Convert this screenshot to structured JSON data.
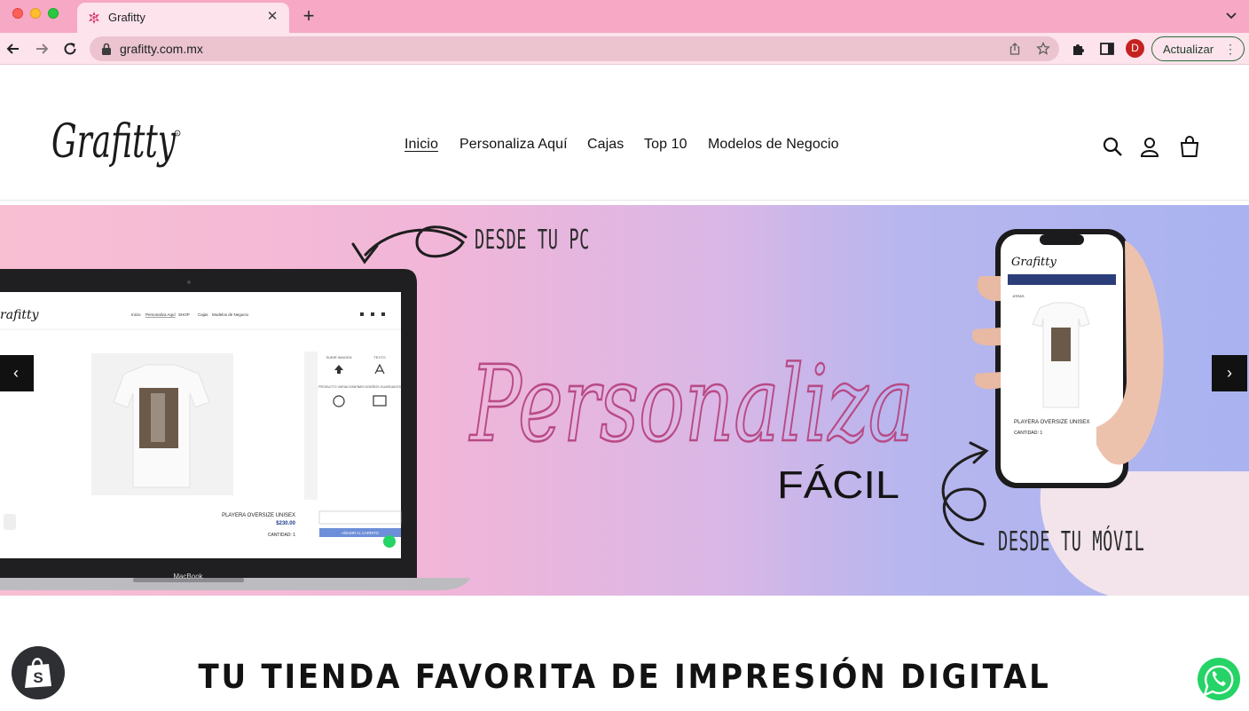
{
  "browser": {
    "tab_title": "Grafitty",
    "new_tab_symbol": "+",
    "url": "grafitty.com.mx",
    "profile_initial": "D",
    "update_label": "Actualizar",
    "update_menu": "⋮"
  },
  "header": {
    "logo_text": "Grafitty",
    "nav": [
      "Inicio",
      "Personaliza Aquí",
      "Cajas",
      "Top 10",
      "Modelos de Negocio"
    ],
    "active_nav": "Inicio"
  },
  "hero": {
    "caption_pc": "DESDE TU PC",
    "caption_movil": "DESDE TU MÓVIL",
    "script_word": "Personaliza",
    "word_facil": "FÁCIL",
    "prev_symbol": "‹",
    "next_symbol": "›",
    "laptop": {
      "logo": "rafitty",
      "nav": [
        "Inicio",
        "Personaliza Aquí",
        "SHOP",
        "Cajas",
        "Modelos de Negocio"
      ],
      "panel_labels": [
        "SUBIR IMAGEN",
        "TEXTO",
        "PRODUCTO VARIACIONES",
        "MIS DISEÑOS GUARDADOS"
      ],
      "product_name": "PLAYERA OVERSIZE UNISEX",
      "price": "$230.00",
      "quantity": "CANTIDAD: 1",
      "add_to_cart": "AÑADIR AL CARRITO",
      "brand": "MacBook"
    },
    "phone": {
      "logo": "Grafitty",
      "back": "ATRÁS",
      "product_name": "PLAYERA OVERSIZE UNISEX",
      "quantity": "CANTIDAD: 1"
    }
  },
  "tagline": "TU TIENDA FAVORITA DE IMPRESIÓN DIGITAL",
  "colors": {
    "tab_bar": "#f6a8c4",
    "toolbar": "#fde3ec",
    "script_pink": "#b84a86",
    "hero_left": "#f8bfd3",
    "hero_right": "#a9b3f0",
    "whatsapp": "#25d366"
  }
}
